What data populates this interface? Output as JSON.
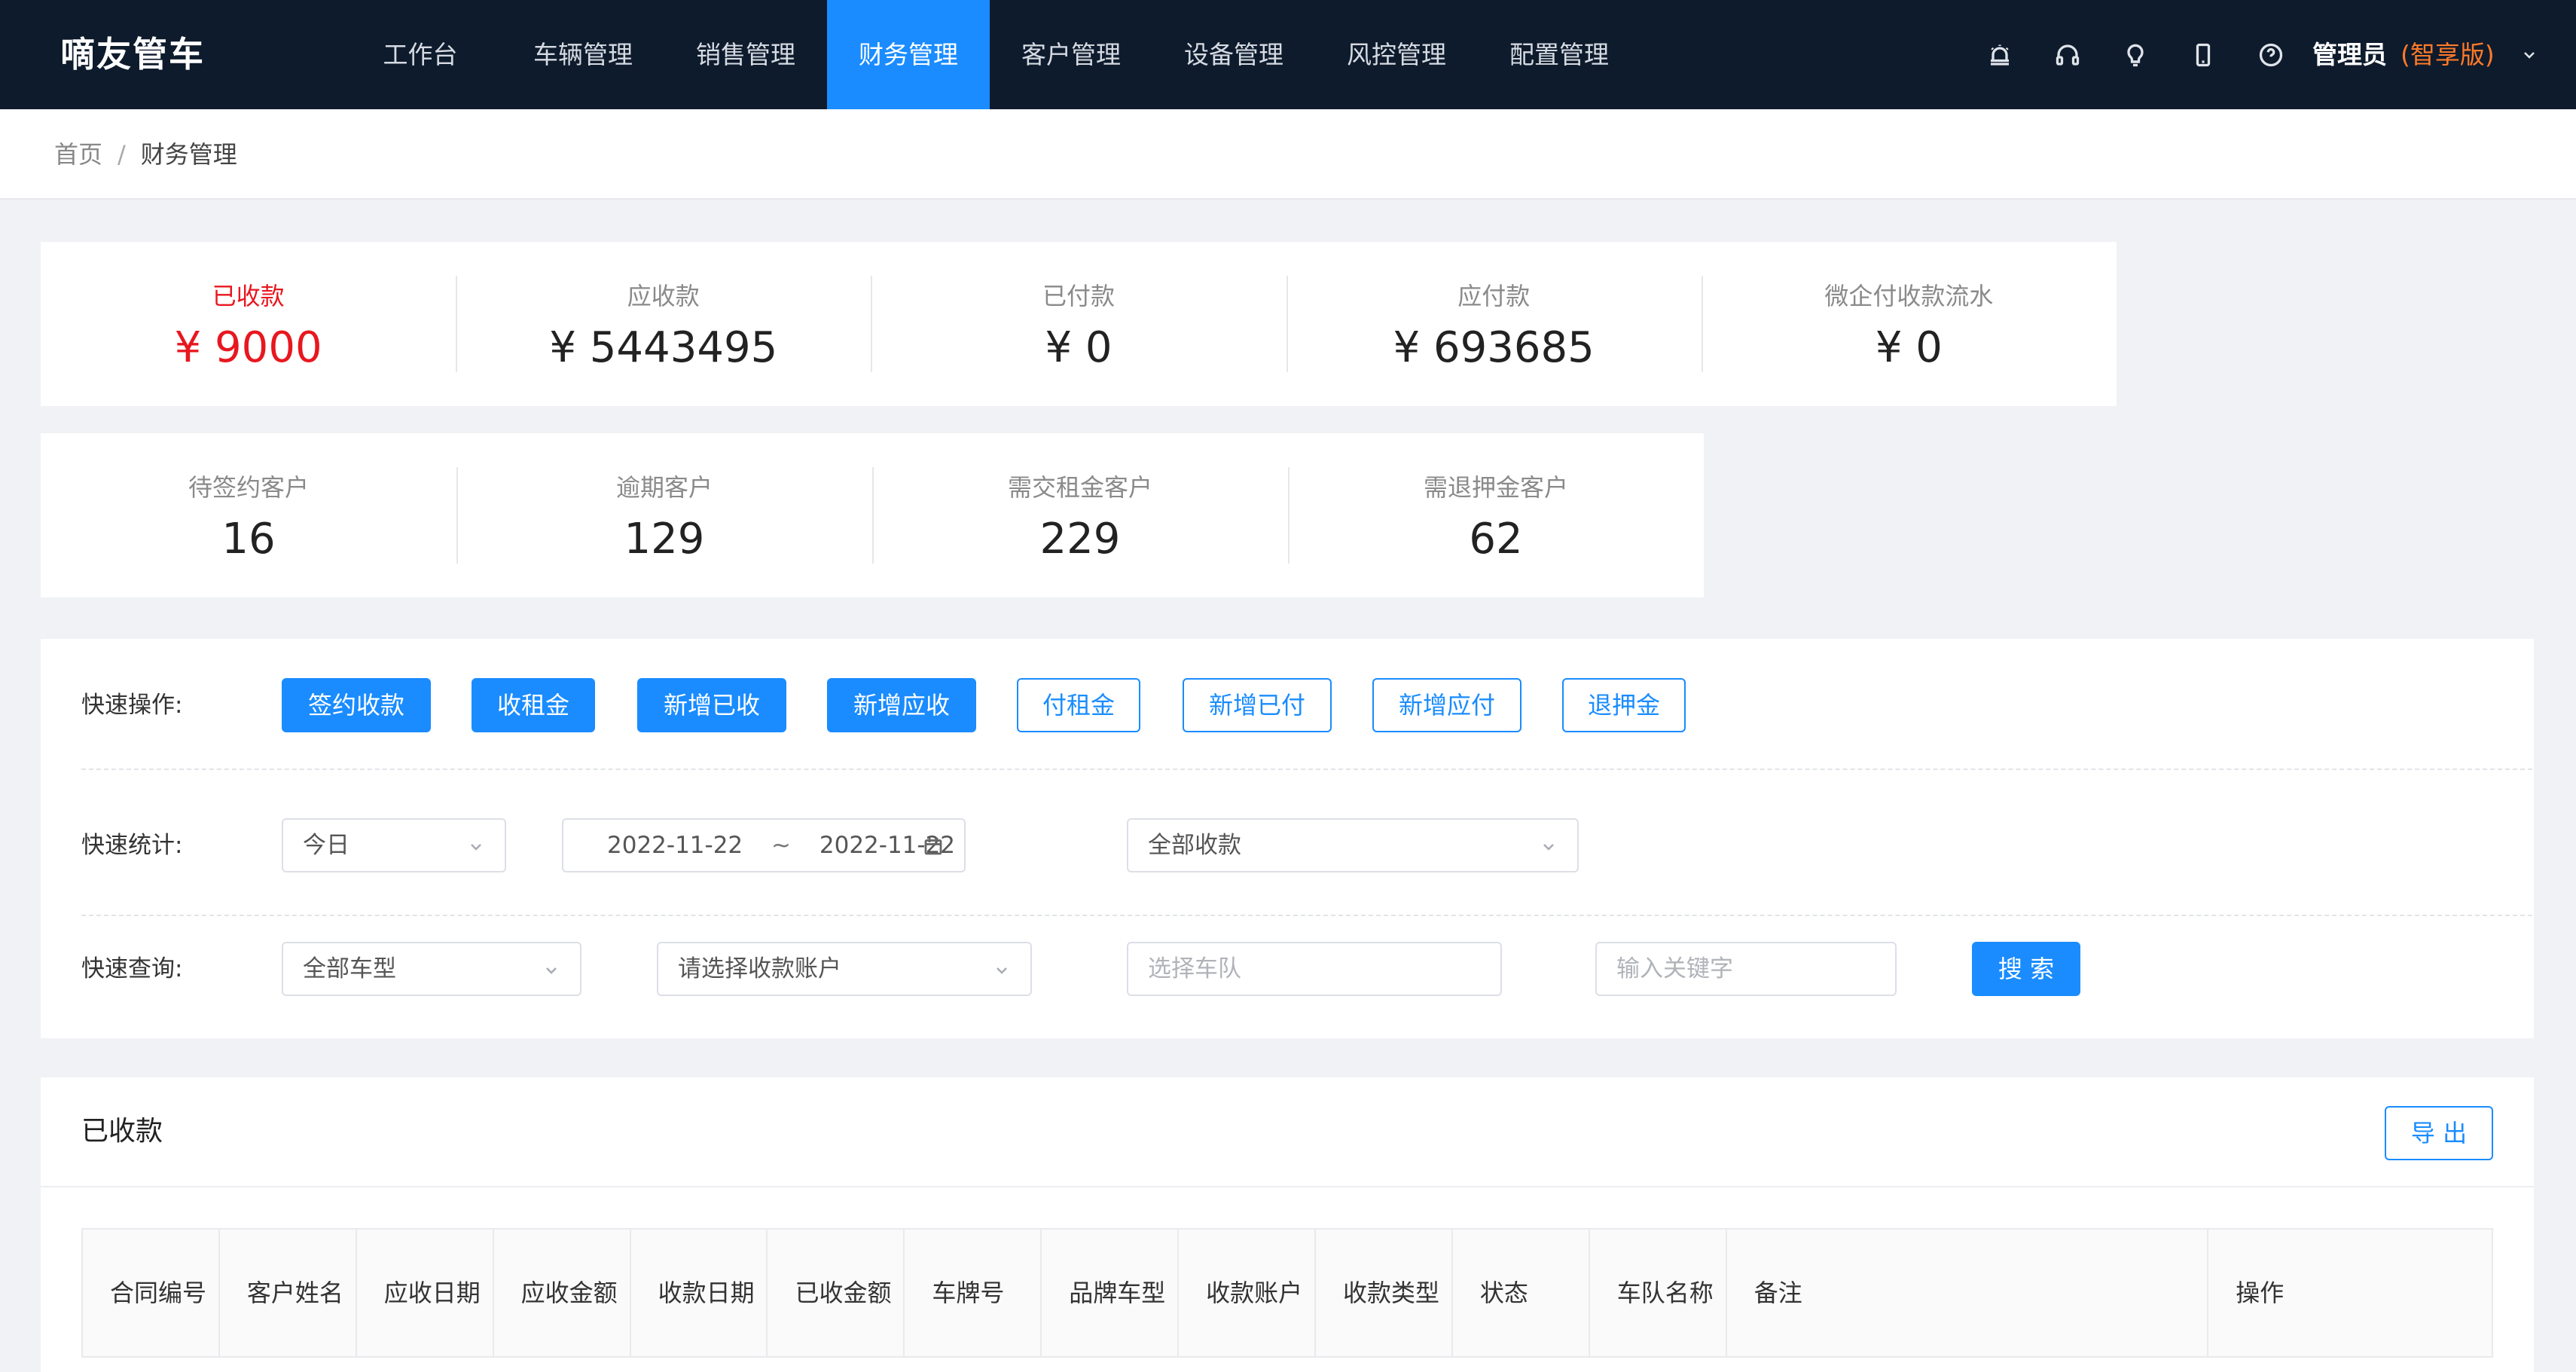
{
  "app": {
    "logo": "嘀友管车"
  },
  "nav": {
    "items": [
      {
        "label": "工作台"
      },
      {
        "label": "车辆管理"
      },
      {
        "label": "销售管理"
      },
      {
        "label": "财务管理"
      },
      {
        "label": "客户管理"
      },
      {
        "label": "设备管理"
      },
      {
        "label": "风控管理"
      },
      {
        "label": "配置管理"
      }
    ],
    "active_index": 3
  },
  "toolbar_icons": [
    "alarm-icon",
    "headset-icon",
    "lightbulb-icon",
    "phone-icon",
    "help-icon"
  ],
  "user": {
    "name": "管理员",
    "edition": "(智享版)"
  },
  "breadcrumb": {
    "home": "首页",
    "separator": "/",
    "current": "财务管理"
  },
  "stats_top": [
    {
      "label": "已收款",
      "value": "¥ 9000"
    },
    {
      "label": "应收款",
      "value": "¥ 5443495"
    },
    {
      "label": "已付款",
      "value": "¥ 0"
    },
    {
      "label": "应付款",
      "value": "¥ 693685"
    },
    {
      "label": "微企付收款流水",
      "value": "¥ 0"
    }
  ],
  "stats_customers": [
    {
      "label": "待签约客户",
      "value": "16"
    },
    {
      "label": "逾期客户",
      "value": "129"
    },
    {
      "label": "需交租金客户",
      "value": "229"
    },
    {
      "label": "需退押金客户",
      "value": "62"
    }
  ],
  "quick_ops": {
    "label": "快速操作:",
    "buttons": [
      "签约收款",
      "收租金",
      "新增已收",
      "新增应收",
      "付租金",
      "新增已付",
      "新增应付",
      "退押金"
    ]
  },
  "quick_stats": {
    "label": "快速统计:",
    "period": "今日",
    "date_start": "2022-11-22",
    "date_sep": "~",
    "date_end": "2022-11-22",
    "type": "全部收款"
  },
  "quick_query": {
    "label": "快速查询:",
    "vehicle_type": "全部车型",
    "account_placeholder": "请选择收款账户",
    "fleet_placeholder": "选择车队",
    "keyword_placeholder": "输入关键字",
    "search_label": "搜 索"
  },
  "table": {
    "title": "已收款",
    "export_label": "导 出",
    "columns": [
      "合同编号",
      "客户姓名",
      "应收日期",
      "应收金额",
      "收款日期",
      "已收金额",
      "车牌号",
      "品牌车型",
      "收款账户",
      "收款类型",
      "状态",
      "车队名称",
      "备注",
      "操作"
    ]
  },
  "colors": {
    "nav_bg": "#0e1b2c",
    "accent": "#1a8cff",
    "alert_red": "#e8171f",
    "edition_orange": "#ff7a29"
  }
}
